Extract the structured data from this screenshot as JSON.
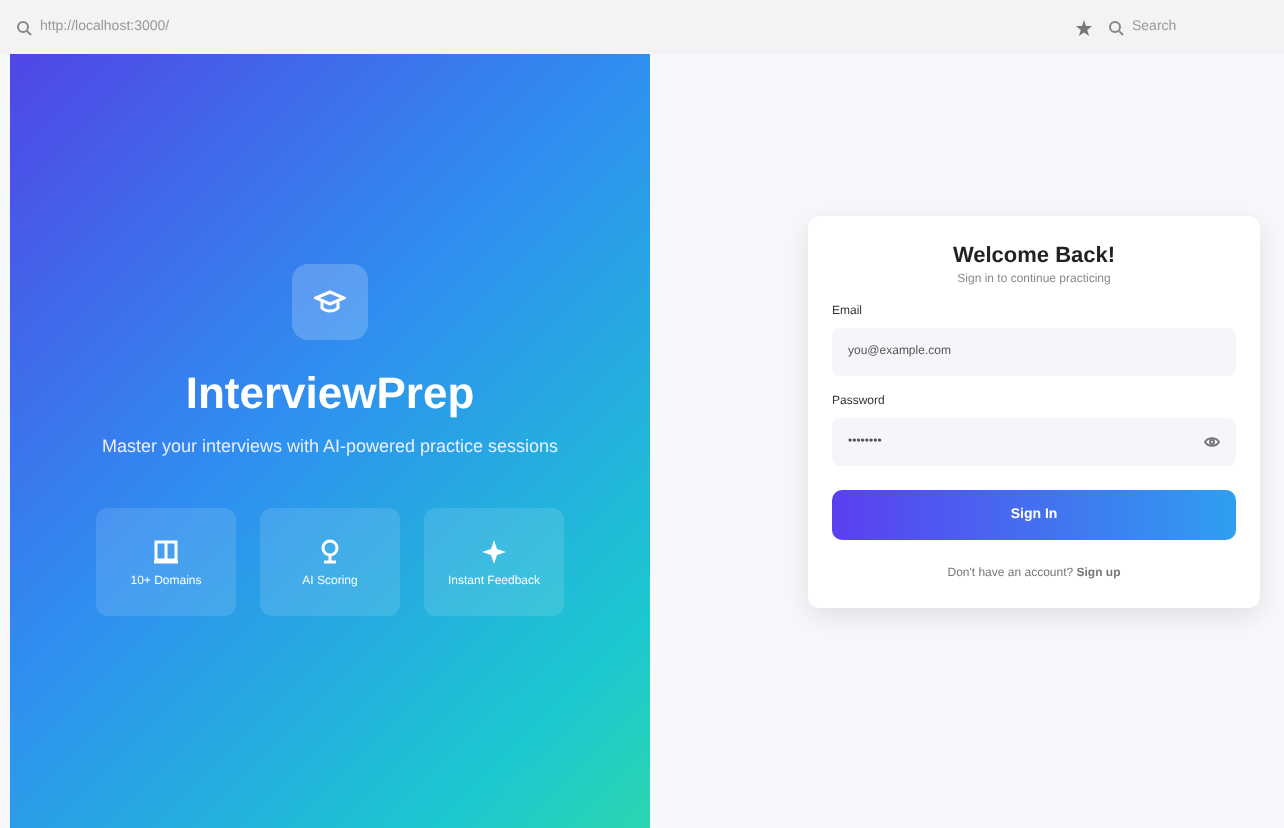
{
  "browser": {
    "url": "http://localhost:3000/",
    "search_placeholder": "Search"
  },
  "hero": {
    "title": "InterviewPrep",
    "tagline": "Master your interviews with AI-powered practice sessions",
    "features": [
      {
        "kind": "book",
        "label": "10+ Domains"
      },
      {
        "kind": "award",
        "label": "AI Scoring"
      },
      {
        "kind": "sparkle",
        "label": "Instant Feedback"
      }
    ]
  },
  "login": {
    "title": "Welcome Back!",
    "subtitle": "Sign in to continue practicing",
    "email_label": "Email",
    "email_value": "you@example.com",
    "password_label": "Password",
    "password_value": "••••••••",
    "submit": "Sign In",
    "footer": "Don't have an account? **Sign up**"
  }
}
